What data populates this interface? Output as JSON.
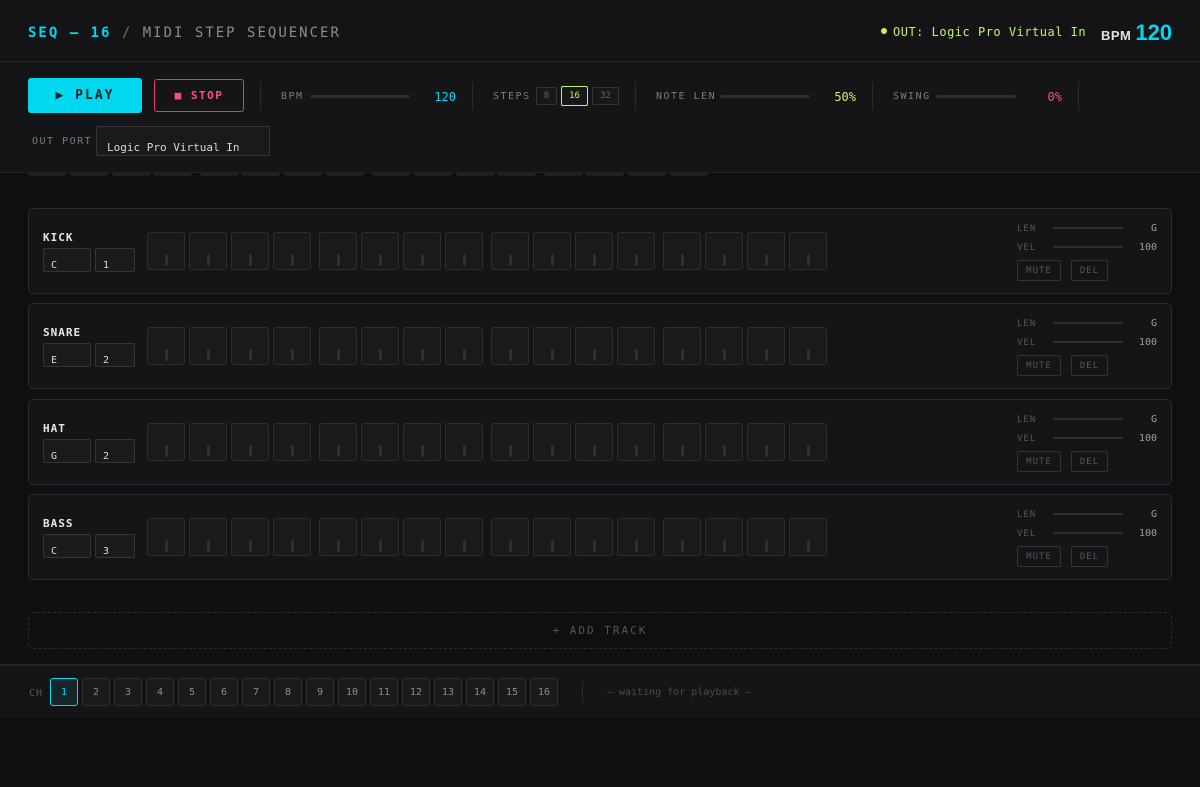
{
  "header": {
    "brand_highlight": "SEQ — 16",
    "brand_separator": "/",
    "brand_subtitle": "MIDI STEP SEQUENCER",
    "out_status": "OUT: Logic Pro Virtual In",
    "bpm_label": "BPM",
    "bpm_value": "120",
    "accent_color": "#00d8f0",
    "status_color": "#c3f262"
  },
  "controls": {
    "play_label": "▶ PLAY",
    "stop_label": "■ STOP",
    "bpm": {
      "label": "BPM",
      "value": "120"
    },
    "steps": {
      "label": "STEPS",
      "options": [
        "8",
        "16",
        "32"
      ],
      "selected": "16"
    },
    "note_len": {
      "label": "NOTE LEN",
      "value": "50%"
    },
    "swing": {
      "label": "SWING",
      "value": "0%"
    },
    "out_port": {
      "label": "OUT PORT",
      "value": "Logic Pro Virtual In"
    }
  },
  "track_labels": {
    "len": "LEN",
    "vel": "VEL",
    "mute": "MUTE",
    "del": "DEL"
  },
  "tracks": [
    {
      "name": "KICK",
      "note": "C",
      "octave": "1",
      "len_value": "G",
      "vel_value": "100"
    },
    {
      "name": "SNARE",
      "note": "E",
      "octave": "2",
      "len_value": "G",
      "vel_value": "100"
    },
    {
      "name": "HAT",
      "note": "G",
      "octave": "2",
      "len_value": "G",
      "vel_value": "100"
    },
    {
      "name": "BASS",
      "note": "C",
      "octave": "3",
      "len_value": "G",
      "vel_value": "100"
    }
  ],
  "add_track_label": "+ ADD TRACK",
  "footer": {
    "channel_label": "CH",
    "channels": [
      "1",
      "2",
      "3",
      "4",
      "5",
      "6",
      "7",
      "8",
      "9",
      "10",
      "11",
      "12",
      "13",
      "14",
      "15",
      "16"
    ],
    "selected_channel": "1",
    "status": "— waiting for playback —"
  }
}
